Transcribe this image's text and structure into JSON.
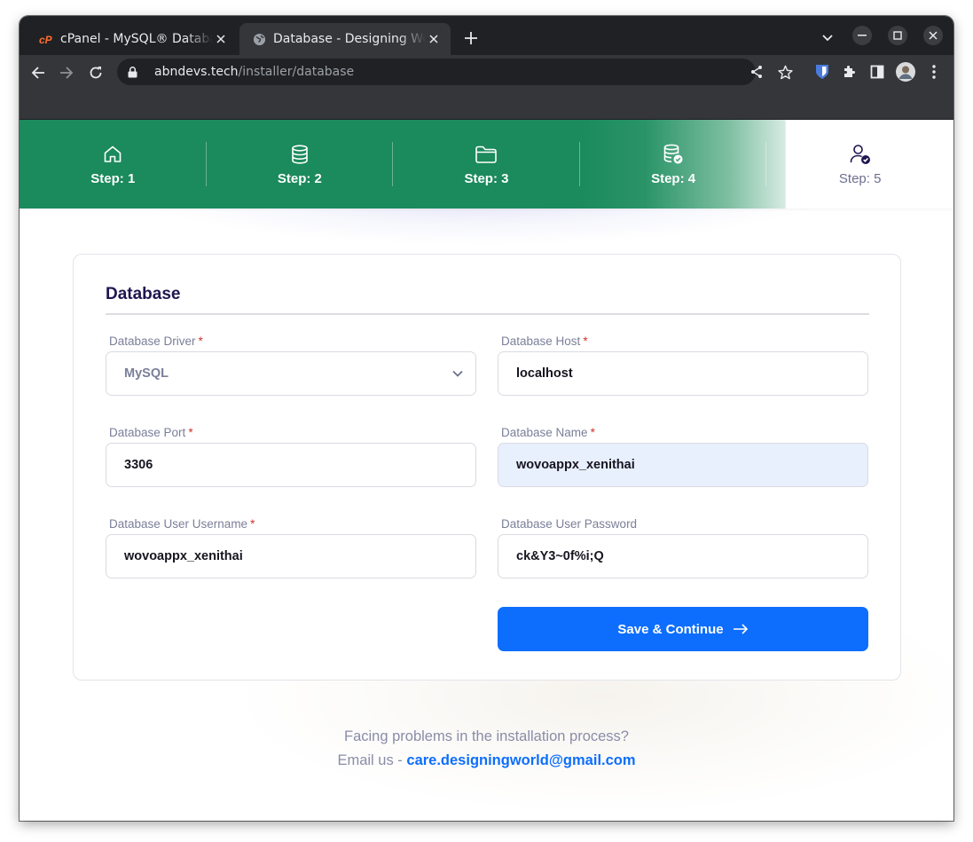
{
  "browser": {
    "tabs": [
      {
        "title": "cPanel - MySQL® Databases",
        "active": false,
        "favicon": "cpanel-icon"
      },
      {
        "title": "Database - Designing World",
        "active": true,
        "favicon": "globe-icon"
      }
    ],
    "url_host": "abndevs.tech",
    "url_path": "/installer/database"
  },
  "steps": [
    {
      "label": "Step: 1",
      "icon": "home-icon",
      "state": "done"
    },
    {
      "label": "Step: 2",
      "icon": "database-icon",
      "state": "done"
    },
    {
      "label": "Step: 3",
      "icon": "folder-icon",
      "state": "done"
    },
    {
      "label": "Step: 4",
      "icon": "database-check-icon",
      "state": "current"
    },
    {
      "label": "Step: 5",
      "icon": "user-check-icon",
      "state": "pending"
    }
  ],
  "form": {
    "title": "Database",
    "required_mark": "*",
    "driver": {
      "label": "Database Driver",
      "value": "MySQL",
      "options": [
        "MySQL"
      ]
    },
    "host": {
      "label": "Database Host",
      "value": "localhost"
    },
    "port": {
      "label": "Database Port",
      "value": "3306"
    },
    "name": {
      "label": "Database Name",
      "value": "wovoappx_xenithai"
    },
    "username": {
      "label": "Database User Username",
      "value": "wovoappx_xenithai"
    },
    "password": {
      "label": "Database User Password",
      "value": "ck&Y3~0f%i;Q"
    },
    "submit_label": "Save & Continue"
  },
  "help": {
    "question": "Facing problems in the installation process?",
    "email_prefix": "Email us - ",
    "email": "care.designingworld@gmail.com"
  },
  "colors": {
    "stepper_green": "#1b8a5c",
    "primary_blue": "#0d6efd",
    "title_navy": "#1f1651",
    "required_red": "#d0342c",
    "autofill_bg": "#e8f0fe"
  }
}
